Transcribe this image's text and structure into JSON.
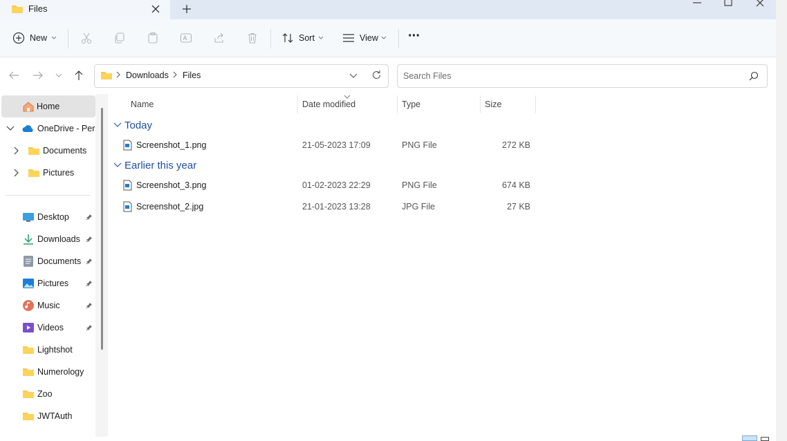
{
  "window": {
    "tab_title": "Files",
    "new_tab_symbol": "+"
  },
  "toolbar": {
    "new_label": "New",
    "sort_label": "Sort",
    "view_label": "View",
    "more_symbol": "···"
  },
  "address": {
    "segments": [
      "Downloads",
      "Files"
    ]
  },
  "search": {
    "placeholder": "Search Files"
  },
  "sidebar": {
    "home": "Home",
    "onedrive": "OneDrive - Perso",
    "onedrive_children": [
      "Documents",
      "Pictures"
    ],
    "quick_access": [
      {
        "label": "Desktop",
        "icon": "desktop-icon",
        "pinned": true
      },
      {
        "label": "Downloads",
        "icon": "downloads-icon",
        "pinned": true
      },
      {
        "label": "Documents",
        "icon": "documents-icon",
        "pinned": true
      },
      {
        "label": "Pictures",
        "icon": "pictures-icon",
        "pinned": true
      },
      {
        "label": "Music",
        "icon": "music-icon",
        "pinned": true
      },
      {
        "label": "Videos",
        "icon": "videos-icon",
        "pinned": true
      },
      {
        "label": "Lightshot",
        "icon": "folder-icon",
        "pinned": false
      },
      {
        "label": "Numerology",
        "icon": "folder-icon",
        "pinned": false
      },
      {
        "label": "Zoo",
        "icon": "folder-icon",
        "pinned": false
      },
      {
        "label": "JWTAuth",
        "icon": "folder-icon",
        "pinned": false
      }
    ]
  },
  "columns": {
    "name": "Name",
    "date": "Date modified",
    "type": "Type",
    "size": "Size"
  },
  "groups": [
    {
      "title": "Today",
      "files": [
        {
          "name": "Screenshot_1.png",
          "date": "21-05-2023 17:09",
          "type": "PNG File",
          "size": "272 KB"
        }
      ]
    },
    {
      "title": "Earlier this year",
      "files": [
        {
          "name": "Screenshot_3.png",
          "date": "01-02-2023 22:29",
          "type": "PNG File",
          "size": "674 KB"
        },
        {
          "name": "Screenshot_2.jpg",
          "date": "21-01-2023 13:28",
          "type": "JPG File",
          "size": "27 KB"
        }
      ]
    }
  ],
  "colors": {
    "accent": "#1f4e9c",
    "folder": "#f7c948",
    "titlebar": "#dfe8f3"
  }
}
